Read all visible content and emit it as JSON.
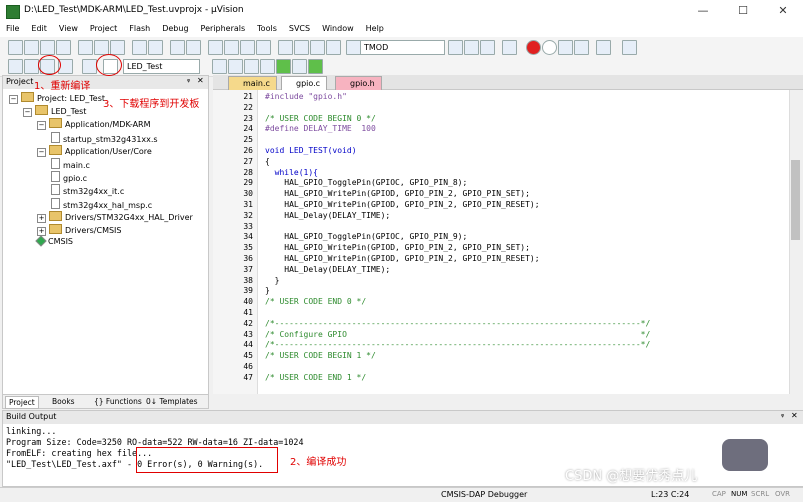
{
  "window": {
    "title": "D:\\LED_Test\\MDK-ARM\\LED_Test.uvprojx - µVision",
    "minimize": "—",
    "maximize": "☐",
    "close": "✕"
  },
  "menu": [
    "File",
    "Edit",
    "View",
    "Project",
    "Flash",
    "Debug",
    "Peripherals",
    "Tools",
    "SVCS",
    "Window",
    "Help"
  ],
  "toolbar": {
    "target_name": "TMOD",
    "project_target": "LED_Test"
  },
  "project": {
    "header": "Project",
    "pin": "ᵠ",
    "close": "✕",
    "tree": [
      {
        "label": "Project: LED_Test",
        "depth": 0,
        "kind": "root"
      },
      {
        "label": "LED_Test",
        "depth": 1,
        "kind": "target"
      },
      {
        "label": "Application/MDK-ARM",
        "depth": 2,
        "kind": "folder"
      },
      {
        "label": "startup_stm32g431xx.s",
        "depth": 3,
        "kind": "file"
      },
      {
        "label": "Application/User/Core",
        "depth": 2,
        "kind": "folder"
      },
      {
        "label": "main.c",
        "depth": 3,
        "kind": "file"
      },
      {
        "label": "gpio.c",
        "depth": 3,
        "kind": "file"
      },
      {
        "label": "stm32g4xx_it.c",
        "depth": 3,
        "kind": "file"
      },
      {
        "label": "stm32g4xx_hal_msp.c",
        "depth": 3,
        "kind": "file"
      },
      {
        "label": "Drivers/STM32G4xx_HAL_Driver",
        "depth": 2,
        "kind": "folder"
      },
      {
        "label": "Drivers/CMSIS",
        "depth": 2,
        "kind": "folder"
      },
      {
        "label": "CMSIS",
        "depth": 2,
        "kind": "gem"
      }
    ],
    "tabs": [
      "Project",
      "Books",
      "{} Functions",
      "0↓ Templates"
    ]
  },
  "editor": {
    "tabs": [
      {
        "label": "main.c",
        "color": "#f5d98b"
      },
      {
        "label": "gpio.c",
        "color": "#ffffff"
      },
      {
        "label": "gpio.h",
        "color": "#f7b3c0"
      }
    ],
    "lines": [
      {
        "n": "21",
        "t": "#include \"gpio.h\"",
        "k": "pp"
      },
      {
        "n": "22",
        "t": "",
        "k": "plain"
      },
      {
        "n": "23",
        "t": "/* USER CODE BEGIN 0 */",
        "k": "cm"
      },
      {
        "n": "24",
        "t": "#define DELAY_TIME  100",
        "k": "pp"
      },
      {
        "n": "25",
        "t": "",
        "k": "plain"
      },
      {
        "n": "26",
        "t": "void LED_TEST(void)",
        "k": "kw"
      },
      {
        "n": "27",
        "t": "{",
        "k": "plain"
      },
      {
        "n": "28",
        "t": "  while(1){",
        "k": "kw"
      },
      {
        "n": "29",
        "t": "    HAL_GPIO_TogglePin(GPIOC, GPIO_PIN_8);",
        "k": "plain"
      },
      {
        "n": "30",
        "t": "    HAL_GPIO_WritePin(GPIOD, GPIO_PIN_2, GPIO_PIN_SET);",
        "k": "plain"
      },
      {
        "n": "31",
        "t": "    HAL_GPIO_WritePin(GPIOD, GPIO_PIN_2, GPIO_PIN_RESET);",
        "k": "plain"
      },
      {
        "n": "32",
        "t": "    HAL_Delay(DELAY_TIME);",
        "k": "plain"
      },
      {
        "n": "33",
        "t": "",
        "k": "plain"
      },
      {
        "n": "34",
        "t": "    HAL_GPIO_TogglePin(GPIOC, GPIO_PIN_9);",
        "k": "plain"
      },
      {
        "n": "35",
        "t": "    HAL_GPIO_WritePin(GPIOD, GPIO_PIN_2, GPIO_PIN_SET);",
        "k": "plain"
      },
      {
        "n": "36",
        "t": "    HAL_GPIO_WritePin(GPIOD, GPIO_PIN_2, GPIO_PIN_RESET);",
        "k": "plain"
      },
      {
        "n": "37",
        "t": "    HAL_Delay(DELAY_TIME);",
        "k": "plain"
      },
      {
        "n": "38",
        "t": "  }",
        "k": "plain"
      },
      {
        "n": "39",
        "t": "}",
        "k": "plain"
      },
      {
        "n": "40",
        "t": "/* USER CODE END 0 */",
        "k": "cm"
      },
      {
        "n": "41",
        "t": "",
        "k": "plain"
      },
      {
        "n": "42",
        "t": "/*----------------------------------------------------------------------------*/",
        "k": "cm"
      },
      {
        "n": "43",
        "t": "/* Configure GPIO                                                             */",
        "k": "cm"
      },
      {
        "n": "44",
        "t": "/*----------------------------------------------------------------------------*/",
        "k": "cm"
      },
      {
        "n": "45",
        "t": "/* USER CODE BEGIN 1 */",
        "k": "cm"
      },
      {
        "n": "46",
        "t": "",
        "k": "plain"
      },
      {
        "n": "47",
        "t": "/* USER CODE END 1 */",
        "k": "cm"
      }
    ]
  },
  "build": {
    "header": "Build Output",
    "lines": [
      "linking...",
      "Program Size: Code=3250 RO-data=522 RW-data=16 ZI-data=1024",
      "FromELF: creating hex file...",
      "\"LED_Test\\LED_Test.axf\" - 0 Error(s), 0 Warning(s)."
    ]
  },
  "status": {
    "debugger": "CMSIS-DAP Debugger",
    "position": "L:23 C:24",
    "caps": "CAP",
    "num": "NUM",
    "scrl": "SCRL",
    "ovr": "OVR"
  },
  "annotations": {
    "compile": "1、重新编译",
    "success": "2、编译成功",
    "download": "3、下载程序到开发板"
  },
  "watermark": "CSDN @想要优秀点儿",
  "colors": {
    "annotation": "#e00000",
    "comment": "#2e8b2e",
    "keyword": "#0000c8",
    "preprocessor": "#7d4b9f"
  }
}
